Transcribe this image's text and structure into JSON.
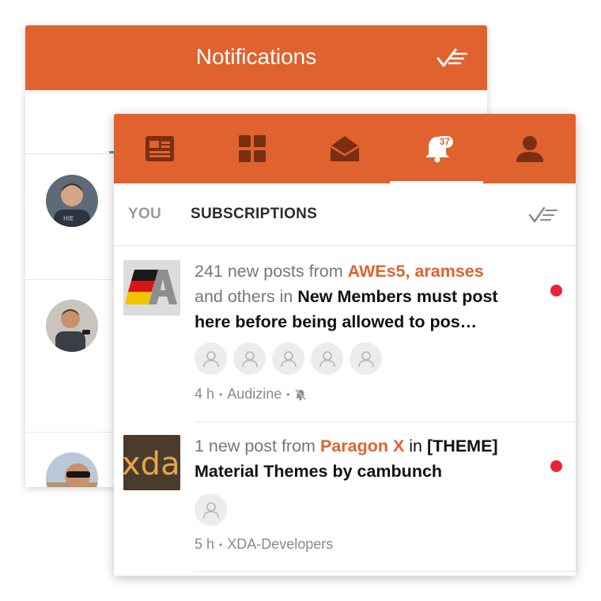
{
  "back_panel": {
    "title": "Notifications",
    "mark_read_icon": "mark-all-read-icon",
    "avatars": [
      "avatar-person-1",
      "avatar-person-2",
      "avatar-person-3"
    ]
  },
  "nav": {
    "tabs": [
      {
        "icon": "news-feed-icon"
      },
      {
        "icon": "grid-forums-icon"
      },
      {
        "icon": "inbox-envelope-icon"
      },
      {
        "icon": "notifications-bell-icon",
        "badge": "37",
        "active": true
      },
      {
        "icon": "profile-person-icon"
      }
    ]
  },
  "sub_tabs": {
    "you": "YOU",
    "subscriptions": "SUBSCRIPTIONS",
    "mark_read_icon": "mark-all-read-icon"
  },
  "notifications": [
    {
      "thumb": "audizine-flag-logo",
      "prefix": "241 new posts from",
      "users": "AWEs5, aramses",
      "middle": "and others in",
      "thread": "New Members must post here before being allowed to pos…",
      "avatar_count": 5,
      "time": "4 h",
      "forum": "Audizine",
      "muted_icon": "bell-off-icon",
      "unread": true
    },
    {
      "thumb": "xda-logo",
      "prefix": "1 new post from",
      "users": "Paragon X",
      "middle": "in",
      "thread": "[THEME] Material Themes by cambunch",
      "avatar_count": 1,
      "time": "5 h",
      "forum": "XDA-Developers",
      "unread": true
    }
  ],
  "colors": {
    "accent": "#e0622e",
    "unread_dot": "#e8243a",
    "text_primary": "#111111",
    "text_secondary": "#777777"
  }
}
